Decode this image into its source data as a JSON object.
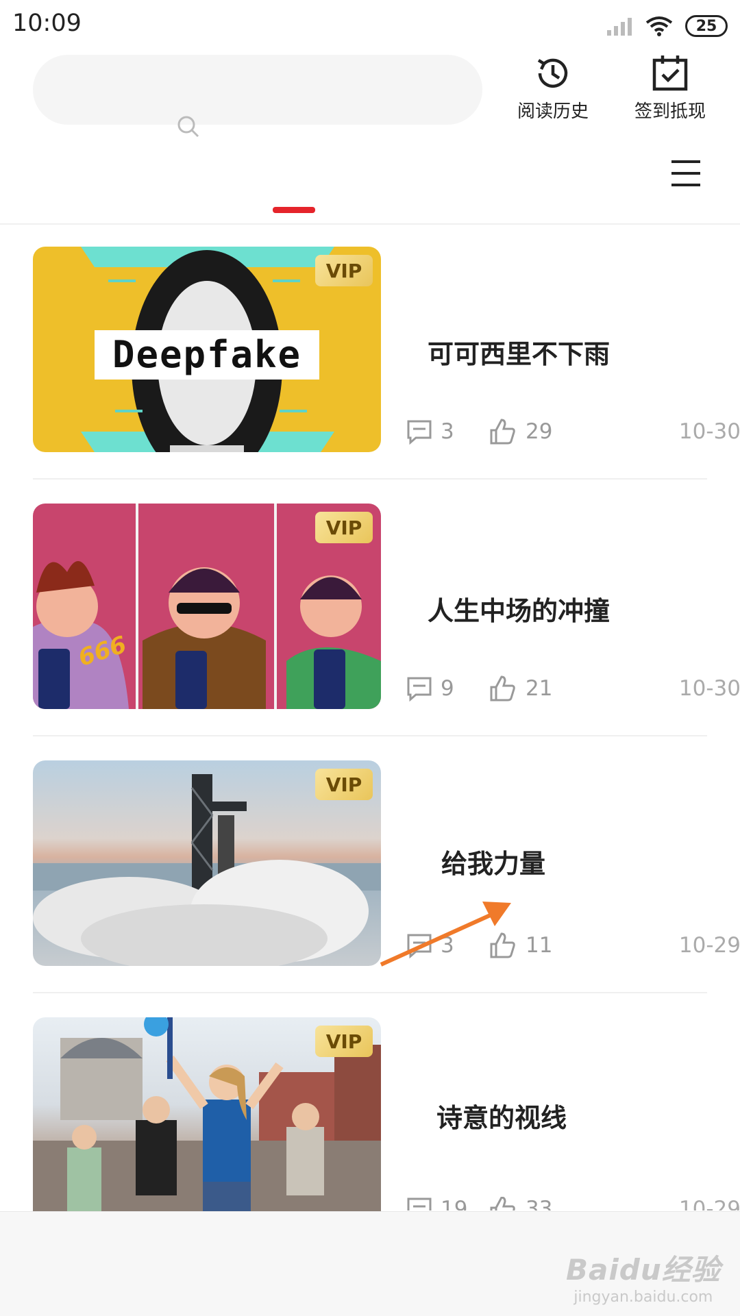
{
  "status_bar": {
    "time": "10:09",
    "battery": "25"
  },
  "header": {
    "search": {
      "placeholder": "",
      "icon": "search-icon"
    },
    "actions": [
      {
        "label": "阅读历史",
        "icon": "history-clock-icon"
      },
      {
        "label": "签到抵现",
        "icon": "calendar-check-icon"
      }
    ],
    "menu_icon": "hamburger-menu-icon",
    "accent_color": "#e5242b"
  },
  "articles": [
    {
      "title": "可可西里不下雨",
      "badge": "VIP",
      "thumb_text": "Deepfake",
      "comments": "3",
      "likes": "29",
      "date": "10-30"
    },
    {
      "title": "人生中场的冲撞",
      "badge": "VIP",
      "thumb_text": "666",
      "comments": "9",
      "likes": "21",
      "date": "10-30"
    },
    {
      "title": "给我力量",
      "badge": "VIP",
      "comments": "3",
      "likes": "11",
      "date": "10-29"
    },
    {
      "title": "诗意的视线",
      "badge": "VIP",
      "comments": "19",
      "likes": "33",
      "date": "10-29"
    }
  ],
  "watermark": {
    "brand": "Baidu经验",
    "url": "jingyan.baidu.com"
  },
  "annotation_arrow_color": "#f07a2a"
}
